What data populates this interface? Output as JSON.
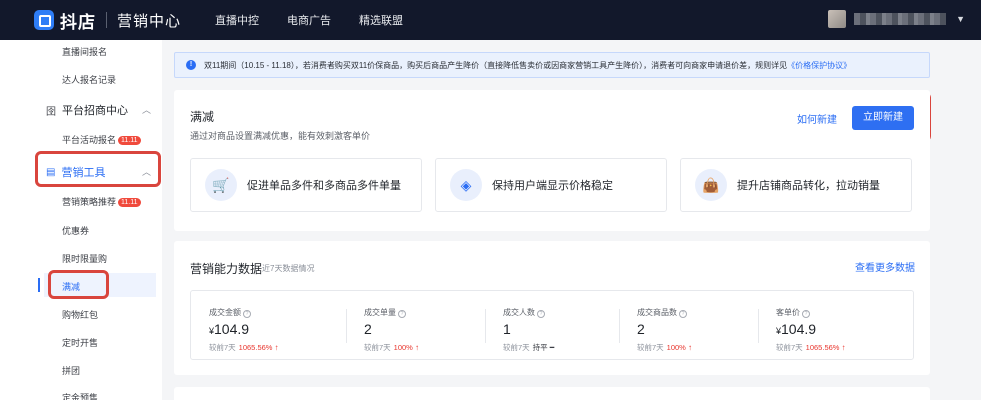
{
  "header": {
    "brand": "抖店",
    "product": "营销中心",
    "nav": [
      "直播中控",
      "电商广告",
      "精选联盟"
    ]
  },
  "sidebar": {
    "items": [
      {
        "label": "直播间报名",
        "type": "item"
      },
      {
        "label": "达人报名记录",
        "type": "item"
      },
      {
        "label": "平台招商中心",
        "type": "group"
      },
      {
        "label": "平台活动报名",
        "type": "item",
        "badge": "11.11"
      },
      {
        "label": "营销工具",
        "type": "group",
        "active": true
      },
      {
        "label": "营销策略推荐",
        "type": "item",
        "badge": "11.11"
      },
      {
        "label": "优惠券",
        "type": "item"
      },
      {
        "label": "限时限量购",
        "type": "item"
      },
      {
        "label": "满减",
        "type": "item",
        "active": true
      },
      {
        "label": "购物红包",
        "type": "item"
      },
      {
        "label": "定时开售",
        "type": "item"
      },
      {
        "label": "拼团",
        "type": "item"
      },
      {
        "label": "定金预售",
        "type": "item"
      }
    ]
  },
  "notice": {
    "text": "双11期间（10.15 - 11.18），若消费者购买双11价保商品，购买后商品产生降价（直接降低售卖价或因商家营销工具产生降价），消费者可向商家申请退价差，规则详见",
    "link": "《价格保护协议》"
  },
  "promo": {
    "title": "满减",
    "description": "通过对商品设置满减优惠，能有效刺激客单价",
    "how_link": "如何新建",
    "new_button": "立即新建",
    "features": [
      {
        "icon": "cart-icon",
        "label": "促进单品多件和多商品多件单量"
      },
      {
        "icon": "price-tag-icon",
        "label": "保持用户端显示价格稳定"
      },
      {
        "icon": "shopping-bag-icon",
        "label": "提升店铺商品转化，拉动销量"
      }
    ]
  },
  "stats": {
    "title": "营销能力数据",
    "subtitle": "近7天数据情况",
    "more_link": "查看更多数据",
    "compare_label": "较前7天",
    "metrics": [
      {
        "label": "成交金额",
        "currency": "¥",
        "value": "104.9",
        "delta": "1065.56%",
        "trend": "up"
      },
      {
        "label": "成交单量",
        "currency": "",
        "value": "2",
        "delta": "100%",
        "trend": "up"
      },
      {
        "label": "成交人数",
        "currency": "",
        "value": "1",
        "delta": "持平",
        "trend": "flat"
      },
      {
        "label": "成交商品数",
        "currency": "",
        "value": "2",
        "delta": "100%",
        "trend": "up"
      },
      {
        "label": "客单价",
        "currency": "¥",
        "value": "104.9",
        "delta": "1065.56%",
        "trend": "up"
      }
    ]
  },
  "colors": {
    "accent": "#2e6ff2",
    "topbar": "#12182b",
    "highlight": "#d9453d",
    "increase": "#e8352d"
  }
}
